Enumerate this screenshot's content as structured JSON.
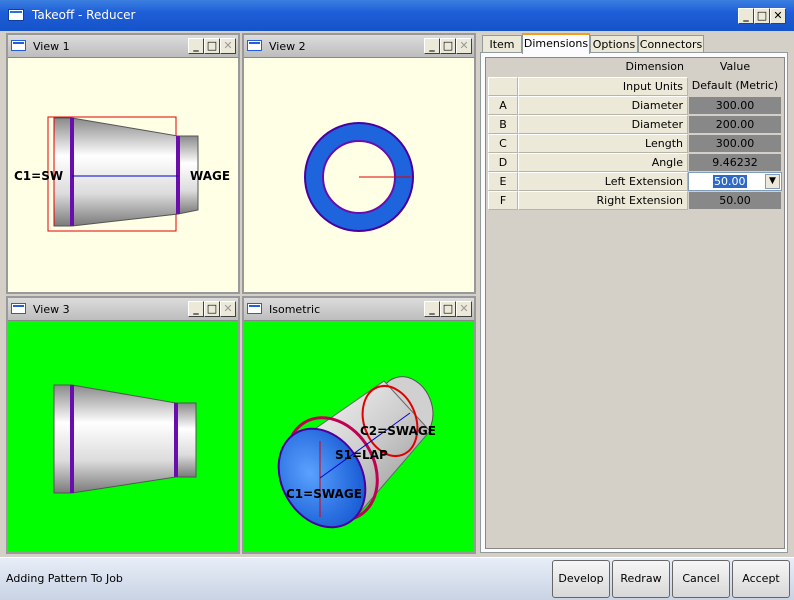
{
  "window": {
    "title": "Takeoff - Reducer",
    "controls": [
      "_",
      "□",
      "✕"
    ]
  },
  "views": [
    {
      "title": "View 1",
      "bg": "#ffffe6",
      "labels": {
        "left": "C1=SW",
        "right": "WAGE"
      }
    },
    {
      "title": "View 2",
      "bg": "#ffffe6"
    },
    {
      "title": "View 3",
      "bg": "#00ff00"
    },
    {
      "title": "Isometric",
      "bg": "#00ff00",
      "labels": {
        "c2": "C2=SWAGE",
        "s1": "S1=LAP",
        "c1": "C1=SWAGE"
      }
    }
  ],
  "pane_controls": [
    "_",
    "□",
    "✕"
  ],
  "tabs": [
    "Item",
    "Dimensions",
    "Options",
    "Connectors"
  ],
  "active_tab": "Dimensions",
  "grid": {
    "header": {
      "dimension": "Dimension",
      "value": "Value"
    },
    "input_units": {
      "label": "Input Units",
      "value": "Default (Metric)"
    },
    "rows": [
      {
        "id": "A",
        "dimension": "Diameter",
        "value": "300.00"
      },
      {
        "id": "B",
        "dimension": "Diameter",
        "value": "200.00"
      },
      {
        "id": "C",
        "dimension": "Length",
        "value": "300.00"
      },
      {
        "id": "D",
        "dimension": "Angle",
        "value": "9.46232"
      },
      {
        "id": "E",
        "dimension": "Left Extension",
        "value": "50.00"
      },
      {
        "id": "F",
        "dimension": "Right Extension",
        "value": "50.00"
      }
    ]
  },
  "status": "Adding Pattern To Job",
  "buttons": {
    "develop": "Develop",
    "redraw": "Redraw",
    "cancel": "Cancel",
    "accept": "Accept"
  },
  "colors": {
    "titlebar": "#1e5ed8",
    "view_bg_light": "#ffffe6",
    "view_bg_green": "#00ff00",
    "pipe_blue": "#1e64dc",
    "edge_purple": "#6a0dad",
    "line_red": "#e00000"
  }
}
